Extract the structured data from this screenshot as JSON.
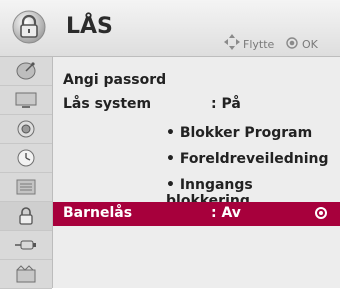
{
  "header": {
    "title": "LÅS",
    "hint_move": "Flytte",
    "hint_ok": "OK",
    "icon": "lock-icon"
  },
  "sidebar": {
    "items": [
      {
        "icon": "satellite-dish-icon"
      },
      {
        "icon": "tv-picture-icon"
      },
      {
        "icon": "speaker-audio-icon"
      },
      {
        "icon": "clock-time-icon"
      },
      {
        "icon": "options-icon"
      },
      {
        "icon": "lock-icon",
        "active": true
      },
      {
        "icon": "usb-input-icon"
      },
      {
        "icon": "media-icon"
      }
    ]
  },
  "menu": {
    "set_password": "Angi passord",
    "lock_system_label": "Lås system",
    "lock_system_value": ": På",
    "block_program": "• Blokker Program",
    "parental_guidance": "• Foreldreveiledning",
    "input_block": "• Inngangs blokkering",
    "child_lock_label": "Barnelås",
    "child_lock_value": ": Av"
  },
  "colors": {
    "selected_row": "#a7003c",
    "background": "#ededed"
  }
}
